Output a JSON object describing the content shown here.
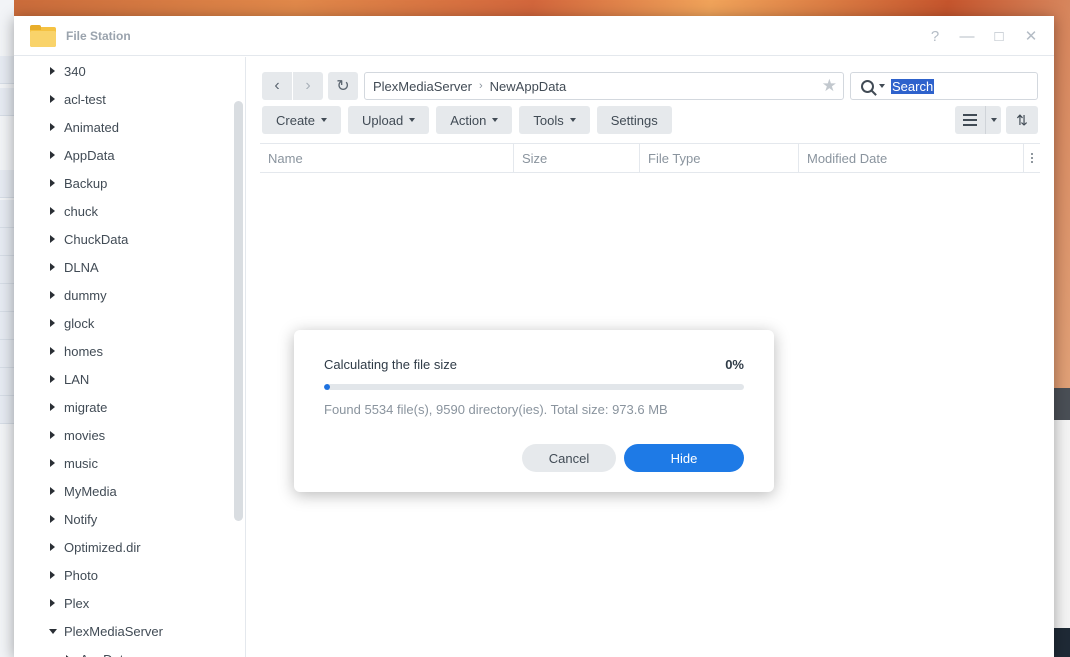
{
  "window": {
    "title": "File Station"
  },
  "sidebar": {
    "items": [
      {
        "label": "340"
      },
      {
        "label": "acl-test"
      },
      {
        "label": "Animated"
      },
      {
        "label": "AppData"
      },
      {
        "label": "Backup"
      },
      {
        "label": "chuck"
      },
      {
        "label": "ChuckData"
      },
      {
        "label": "DLNA"
      },
      {
        "label": "dummy"
      },
      {
        "label": "glock"
      },
      {
        "label": "homes"
      },
      {
        "label": "LAN"
      },
      {
        "label": "migrate"
      },
      {
        "label": "movies"
      },
      {
        "label": "music"
      },
      {
        "label": "MyMedia"
      },
      {
        "label": "Notify"
      },
      {
        "label": "Optimized.dir"
      },
      {
        "label": "Photo"
      },
      {
        "label": "Plex"
      },
      {
        "label": "PlexMediaServer"
      }
    ],
    "child_item": "AppData"
  },
  "path": {
    "segments": [
      "PlexMediaServer",
      "NewAppData"
    ]
  },
  "search": {
    "value": "Search"
  },
  "toolbar": {
    "create": "Create",
    "upload": "Upload",
    "action": "Action",
    "tools": "Tools",
    "settings": "Settings"
  },
  "columns": [
    "Name",
    "Size",
    "File Type",
    "Modified Date"
  ],
  "dialog": {
    "title": "Calculating the file size",
    "percent": "0%",
    "progress": 0,
    "info": "Found 5534 file(s), 9590 directory(ies). Total size: 973.6 MB",
    "cancel": "Cancel",
    "hide": "Hide"
  },
  "colors": {
    "accent": "#1e7ae6",
    "folder": "#f5c242"
  }
}
